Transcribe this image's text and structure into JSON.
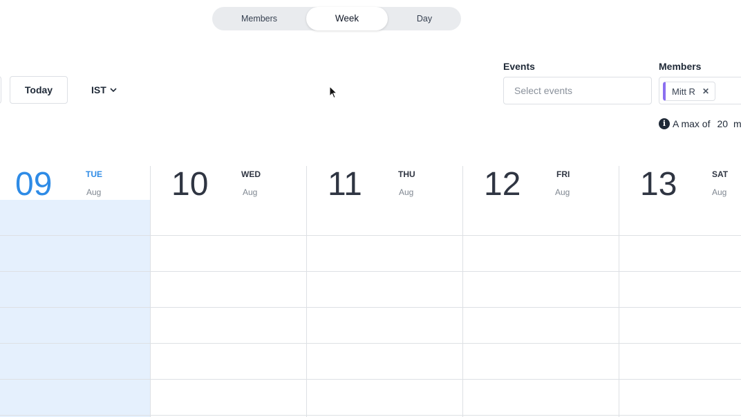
{
  "view_switcher": {
    "tabs": [
      {
        "label": "Members",
        "active": false
      },
      {
        "label": "Week",
        "active": true
      },
      {
        "label": "Day",
        "active": false
      }
    ]
  },
  "toolbar": {
    "today_label": "Today",
    "timezone_label": "IST"
  },
  "filters": {
    "events_label": "Events",
    "events_placeholder": "Select events",
    "members_label": "Members",
    "selected_members": [
      "Mitt R"
    ],
    "member_chip_color": "#8b6ff0",
    "info_text_prefix": "A max of",
    "info_text_number": "20",
    "info_text_suffix": "me"
  },
  "calendar": {
    "today_color": "#2e8be6",
    "today_bg_color": "#e5f0fd",
    "days": [
      {
        "num": "09",
        "name": "TUE",
        "month": "Aug",
        "today": true
      },
      {
        "num": "10",
        "name": "WED",
        "month": "Aug",
        "today": false
      },
      {
        "num": "11",
        "name": "THU",
        "month": "Aug",
        "today": false
      },
      {
        "num": "12",
        "name": "FRI",
        "month": "Aug",
        "today": false
      },
      {
        "num": "13",
        "name": "SAT",
        "month": "Aug",
        "today": false
      }
    ]
  }
}
